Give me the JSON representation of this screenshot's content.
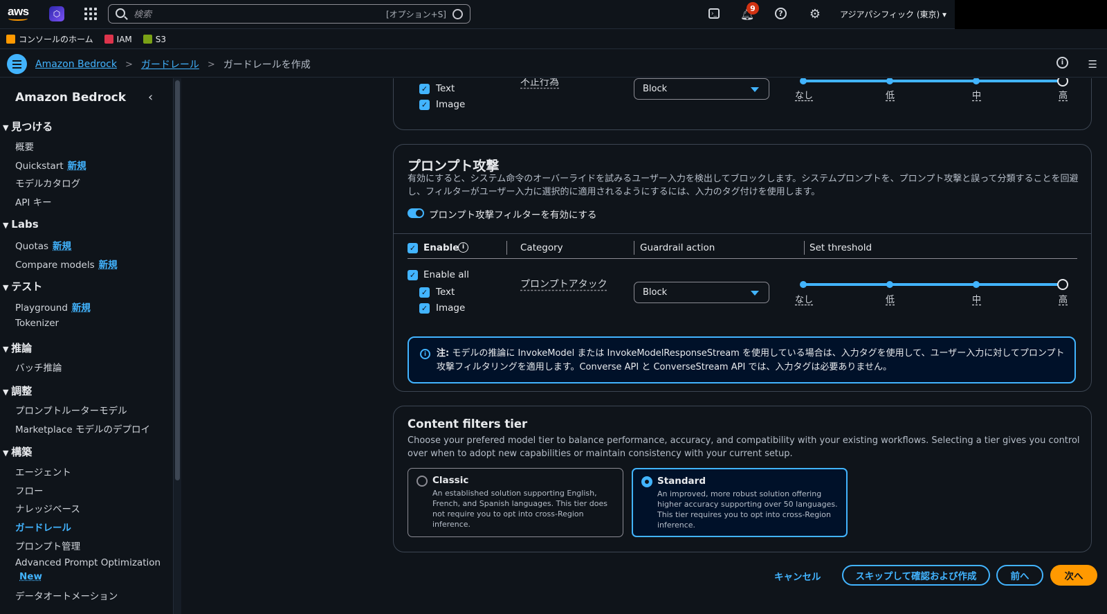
{
  "topbar": {
    "logo": "aws",
    "search_placeholder": "検索",
    "search_shortcut": "[オプション+S]",
    "notifications_count": "9",
    "region": "アジアパシフィック (東京)"
  },
  "favorites": [
    {
      "label": "コンソールのホーム",
      "color": "#ff9900"
    },
    {
      "label": "IAM",
      "color": "#dd344c"
    },
    {
      "label": "S3",
      "color": "#7aa116"
    }
  ],
  "breadcrumbs": {
    "items": [
      "Amazon Bedrock",
      "ガードレール"
    ],
    "current": "ガードレールを作成"
  },
  "sidebar": {
    "title": "Amazon Bedrock",
    "new_label": "新規",
    "sections": {
      "discover": "見つける",
      "labs": "Labs",
      "test": "テスト",
      "inference": "推論",
      "tuning": "調整",
      "build": "構築"
    },
    "items": {
      "overview": "概要",
      "quickstart": "Quickstart",
      "model_catalog": "モデルカタログ",
      "api_keys": "API キー",
      "quotas": "Quotas",
      "compare_models": "Compare models",
      "playground": "Playground",
      "tokenizer": "Tokenizer",
      "batch_inference": "バッチ推論",
      "prompt_router_model": "プロンプトルーターモデル",
      "marketplace": "Marketplace モデルのデプロイ",
      "agents": "エージェント",
      "flows": "フロー",
      "knowledge_base": "ナレッジベース",
      "guardrails": "ガードレール",
      "prompt_management": "プロンプト管理",
      "advanced_prompt_optimization": "Advanced Prompt Optimization",
      "new_en": "New",
      "data_automation": "データオートメーション"
    }
  },
  "top_card": {
    "text_label": "Text",
    "image_label": "Image",
    "category": "不正行為",
    "action": "Block",
    "thresholds": [
      "なし",
      "低",
      "中",
      "高"
    ],
    "threshold_value": "高"
  },
  "prompt_attack": {
    "title": "プロンプト攻撃",
    "description": "有効にすると、システム命令のオーバーライドを試みるユーザー入力を検出してブロックします。システムプロンプトを、プロンプト攻撃と誤って分類することを回避し、フィルターがユーザー入力に選択的に適用されるようにするには、入力のタグ付けを使用します。",
    "toggle_label": "プロンプト攻撃フィルターを有効にする",
    "toggle_on": true,
    "headers": {
      "enable": "Enable",
      "category": "Category",
      "action": "Guardrail action",
      "threshold": "Set threshold"
    },
    "enable_all": "Enable all",
    "text_label": "Text",
    "image_label": "Image",
    "category": "プロンプトアタック",
    "action": "Block",
    "thresholds": [
      "なし",
      "低",
      "中",
      "高"
    ],
    "threshold_value": "高",
    "note_bold": "注:",
    "note_text": " モデルの推論に InvokeModel または InvokeModelResponseStream を使用している場合は、入力タグを使用して、ユーザー入力に対してプロンプト攻撃フィルタリングを適用します。Converse API と ConverseStream API では、入力タグは必要ありません。"
  },
  "tier": {
    "title": "Content filters tier",
    "description": "Choose your prefered model tier to balance performance, accuracy, and compatibility with your existing workflows. Selecting a tier gives you control over when to adopt new capabilities or maintain consistency with your current setup.",
    "options": [
      {
        "title": "Classic",
        "description": "An established solution supporting English, French, and Spanish languages. This tier does not require you to opt into cross-Region inference.",
        "selected": false
      },
      {
        "title": "Standard",
        "description": "An improved, more robust solution offering higher accuracy supporting over 50 languages. This tier requires you to opt into cross-Region inference.",
        "selected": true
      }
    ]
  },
  "footer": {
    "cancel": "キャンセル",
    "skip": "スキップして確認および作成",
    "previous": "前へ",
    "next": "次へ"
  },
  "colors": {
    "accent": "#42b4ff",
    "primary_button": "#ff9900",
    "background": "#0f141a"
  }
}
